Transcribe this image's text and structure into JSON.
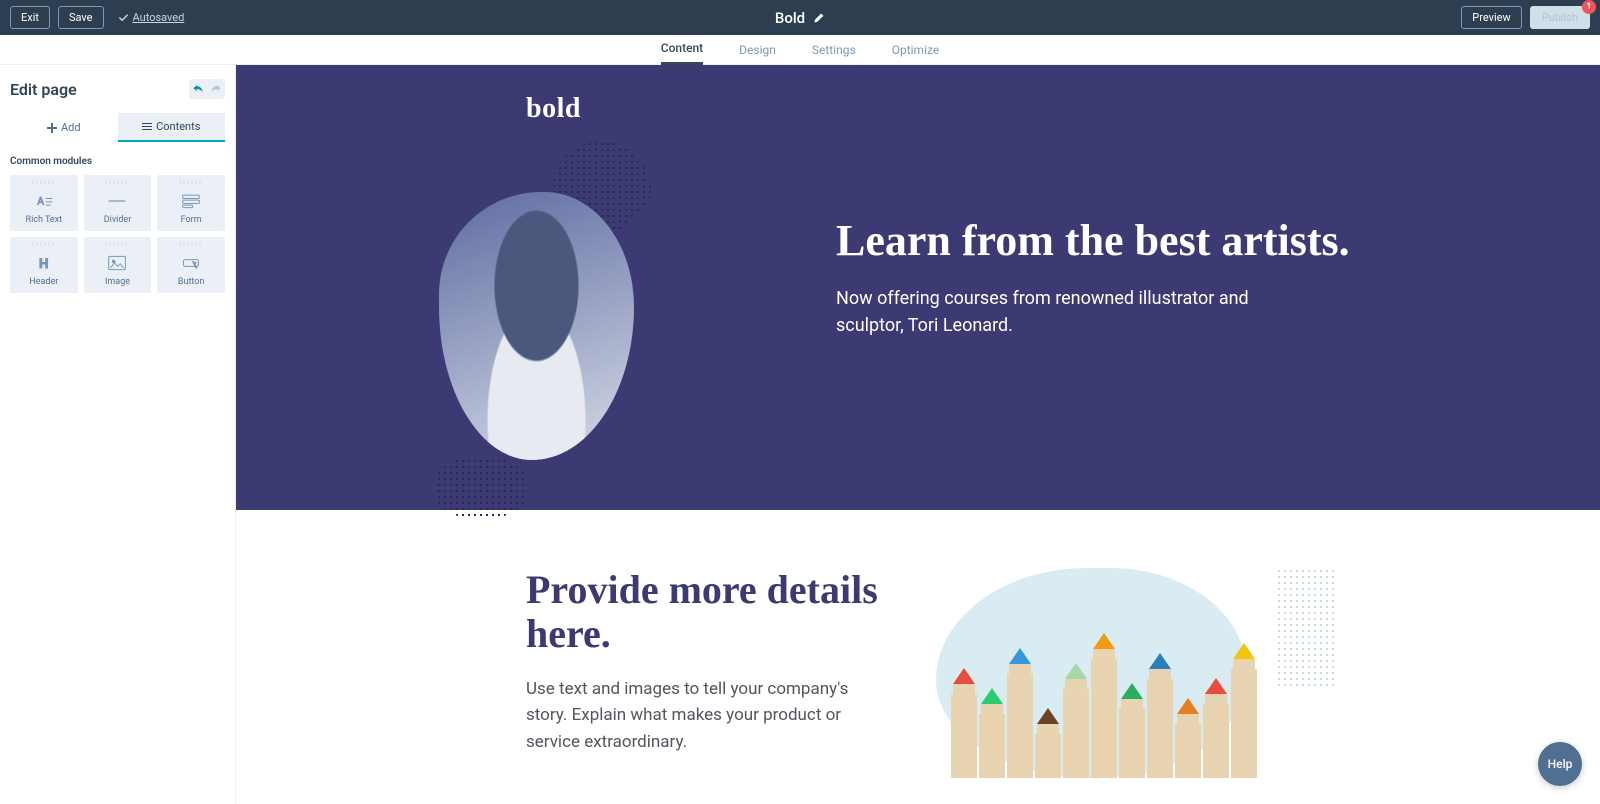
{
  "topbar": {
    "exit": "Exit",
    "save": "Save",
    "autosaved": "Autosaved",
    "title": "Bold",
    "preview": "Preview",
    "publish": "Publish",
    "badge": "1"
  },
  "navtabs": [
    "Content",
    "Design",
    "Settings",
    "Optimize"
  ],
  "activeNavTab": 0,
  "sidebar": {
    "title": "Edit page",
    "tab_add": "Add",
    "tab_contents": "Contents",
    "section_label": "Common modules",
    "modules": [
      {
        "label": "Rich Text",
        "icon": "richtext"
      },
      {
        "label": "Divider",
        "icon": "divider"
      },
      {
        "label": "Form",
        "icon": "form"
      },
      {
        "label": "Header",
        "icon": "header"
      },
      {
        "label": "Image",
        "icon": "image"
      },
      {
        "label": "Button",
        "icon": "button"
      }
    ]
  },
  "canvas": {
    "logo": "bold",
    "hero_heading": "Learn from the best artists.",
    "hero_body": "Now offering courses from renowned illustrator and sculptor, Tori Leonard.",
    "sec2_heading": "Provide more details here.",
    "sec2_body": "Use text and images to tell your company's story. Explain what makes your product or service extraordinary.",
    "pencil_colors": [
      "#e74c3c",
      "#2ecc71",
      "#3498db",
      "#6b4423",
      "#a8d8a8",
      "#f39c12",
      "#27ae60",
      "#2980b9",
      "#e67e22",
      "#e74c3c",
      "#f1c40f"
    ]
  },
  "help": "Help"
}
